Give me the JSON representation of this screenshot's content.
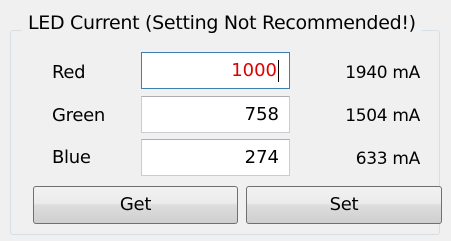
{
  "group": {
    "title": "LED Current (Setting Not Recommended!)"
  },
  "rows": [
    {
      "label": "Red",
      "value": "1000",
      "readout": "1940 mA"
    },
    {
      "label": "Green",
      "value": "758",
      "readout": "1504 mA"
    },
    {
      "label": "Blue",
      "value": "274",
      "readout": "633 mA"
    }
  ],
  "buttons": {
    "get_label": "Get",
    "set_label": "Set"
  },
  "colors": {
    "focused_value_text": "#e00000",
    "focus_border": "#3c7fb1",
    "groupbox_border": "#d5dfe5",
    "background": "#f0f0f0"
  }
}
